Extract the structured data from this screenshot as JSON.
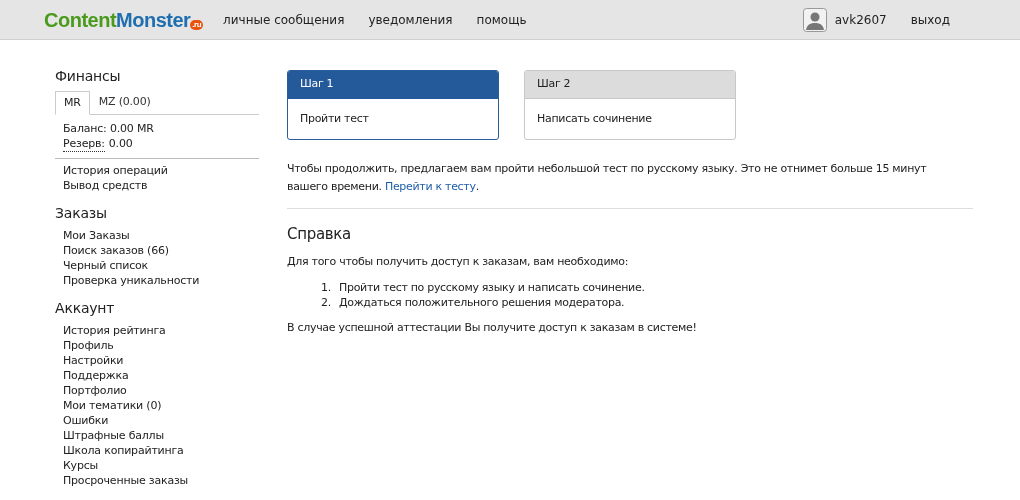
{
  "header": {
    "logo": {
      "part_1": "Content",
      "part_2": "Monster",
      "badge": ".ru"
    },
    "nav": [
      "личные сообщения",
      "уведомления",
      "помощь"
    ],
    "user": {
      "name": "avk2607",
      "logout": "выход"
    }
  },
  "sidebar": {
    "finance": {
      "title": "Финансы",
      "tabs": [
        {
          "label": "MR",
          "selected": true
        },
        {
          "label": "MZ (0.00)",
          "selected": false
        }
      ],
      "balance": "Баланс: 0.00 MR",
      "reserve_label": "Резерв:",
      "reserve_value": "0.00",
      "links": [
        "История операций",
        "Вывод средств"
      ]
    },
    "sections": [
      {
        "title": "Заказы",
        "items": [
          "Мои Заказы",
          "Поиск заказов (66)",
          "Черный список",
          "Проверка уникальности"
        ]
      },
      {
        "title": "Аккаунт",
        "items": [
          "История рейтинга",
          "Профиль",
          "Настройки",
          "Поддержка",
          "Портфолио",
          "Мои тематики (0)",
          "Ошибки",
          "Штрафные баллы",
          "Школа копирайтинга",
          "Курсы",
          "Просроченные заказы"
        ]
      }
    ]
  },
  "steps": [
    {
      "header": "Шаг 1",
      "body": "Пройти тест",
      "selected": true
    },
    {
      "header": "Шаг 2",
      "body": "Написать сочинение",
      "selected": false
    }
  ],
  "intro": {
    "text": "Чтобы продолжить, предлагаем вам пройти небольшой тест по русскому языку. Это не отнимет больше 15 минут вашего времени.",
    "link": "Перейти к тесту",
    "suffix": "."
  },
  "help": {
    "title": "Справка",
    "lead": "Для того чтобы получить доступ к заказам, вам необходимо:",
    "steps": [
      {
        "number": "1.",
        "text": "Пройти тест по русскому языку и написать сочинение."
      },
      {
        "number": "2.",
        "text": "Дождаться положительного решения модератора."
      }
    ],
    "footer": "В случае успешной аттестации Вы получите доступ к заказам в системе!"
  }
}
